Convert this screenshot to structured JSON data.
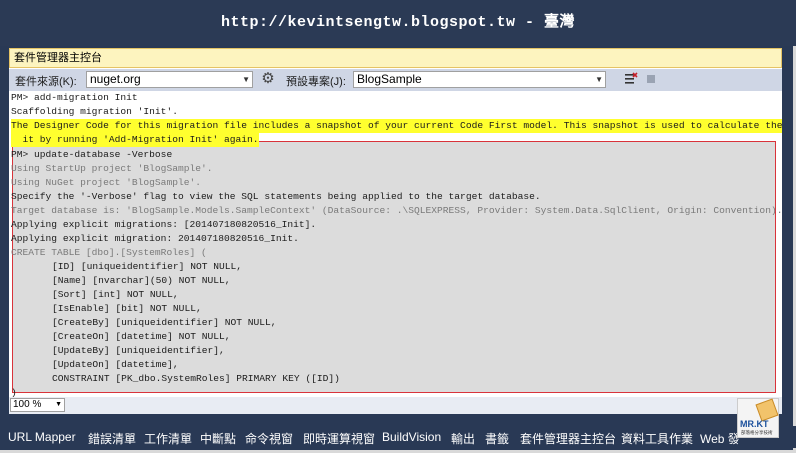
{
  "banner": {
    "url": "http://kevintsengtw.blogspot.tw - 臺灣"
  },
  "window": {
    "title": "套件管理器主控台"
  },
  "toolbar": {
    "source_label": "套件來源(K):",
    "source_value": "nuget.org",
    "project_label": "預設專案(J):",
    "project_value": "BlogSample"
  },
  "console": {
    "lines": [
      "PM> add-migration Init",
      "Scaffolding migration 'Init'.",
      "The Designer Code for this migration file includes a snapshot of your current Code First model. This snapshot is used to calculate the cl",
      "  it by running 'Add-Migration Init' again.",
      "PM> update-database -Verbose",
      "Using StartUp project 'BlogSample'.",
      "Using NuGet project 'BlogSample'.",
      "Specify the '-Verbose' flag to view the SQL statements being applied to the target database.",
      "Target database is: 'BlogSample.Models.SampleContext' (DataSource: .\\SQLEXPRESS, Provider: System.Data.SqlClient, Origin: Convention).",
      "Applying explicit migrations: [201407180820516_Init].",
      "Applying explicit migration: 201407180820516_Init.",
      "CREATE TABLE [dbo].[SystemRoles] (",
      "    [ID] [uniqueidentifier] NOT NULL,",
      "    [Name] [nvarchar](50) NOT NULL,",
      "    [Sort] [int] NOT NULL,",
      "    [IsEnable] [bit] NOT NULL,",
      "    [CreateBy] [uniqueidentifier] NOT NULL,",
      "    [CreateOn] [datetime] NOT NULL,",
      "    [UpdateBy] [uniqueidentifier],",
      "    [UpdateOn] [datetime],",
      "    CONSTRAINT [PK_dbo.SystemRoles] PRIMARY KEY ([ID])",
      ")"
    ]
  },
  "zoom": {
    "value": "100 %"
  },
  "tabs": [
    "URL Mapper",
    "錯誤清單",
    "工作清單",
    "中斷點",
    "命令視窗",
    "即時運算視窗",
    "BuildVision",
    "輸出",
    "書籤",
    "套件管理器主控台",
    "資料工具作業",
    "Web 發"
  ],
  "logo": {
    "text": "MR.KT",
    "subtext": "部落格分享技術"
  },
  "colors": {
    "chrome": "#293955",
    "title_bar": "#fdf4bf",
    "highlight": "#ffff2e",
    "selection_border": "#d9333a"
  }
}
